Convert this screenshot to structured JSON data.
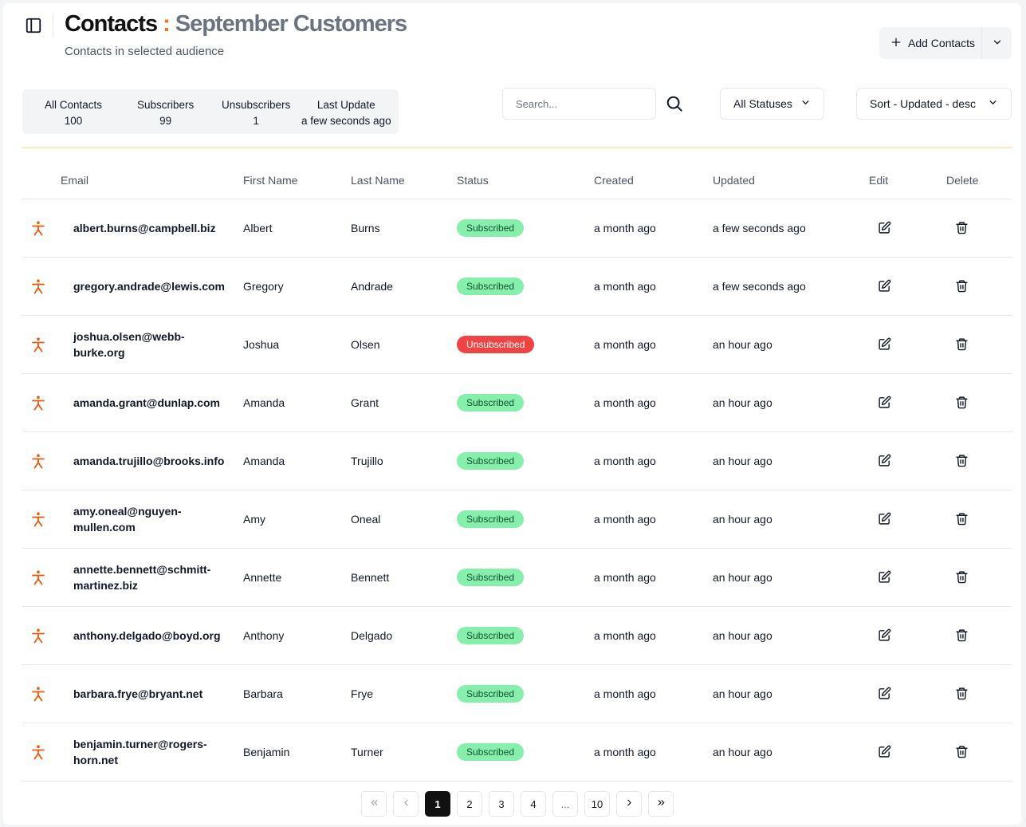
{
  "header": {
    "title_main": "Contacts",
    "title_separator": ":",
    "title_audience": "September Customers",
    "subtitle": "Contacts in selected audience",
    "add_button": "Add Contacts"
  },
  "stats": {
    "all": {
      "label": "All Contacts",
      "value": "100"
    },
    "subscribers": {
      "label": "Subscribers",
      "value": "99"
    },
    "unsubscribers": {
      "label": "Unsubscribers",
      "value": "1"
    },
    "last_update": {
      "label": "Last Update",
      "value": "a few seconds ago"
    }
  },
  "search": {
    "placeholder": "Search..."
  },
  "filters": {
    "status": "All Statuses",
    "sort": "Sort - Updated - desc"
  },
  "table": {
    "headers": {
      "email": "Email",
      "first": "First Name",
      "last": "Last Name",
      "status": "Status",
      "created": "Created",
      "updated": "Updated",
      "edit": "Edit",
      "delete": "Delete"
    },
    "rows": [
      {
        "email": "albert.burns@campbell.biz",
        "first": "Albert",
        "last": "Burns",
        "status": "Subscribed",
        "created": "a month ago",
        "updated": "a few seconds ago"
      },
      {
        "email": "gregory.andrade@lewis.com",
        "first": "Gregory",
        "last": "Andrade",
        "status": "Subscribed",
        "created": "a month ago",
        "updated": "a few seconds ago"
      },
      {
        "email": "joshua.olsen@webb-burke.org",
        "first": "Joshua",
        "last": "Olsen",
        "status": "Unsubscribed",
        "created": "a month ago",
        "updated": "an hour ago"
      },
      {
        "email": "amanda.grant@dunlap.com",
        "first": "Amanda",
        "last": "Grant",
        "status": "Subscribed",
        "created": "a month ago",
        "updated": "an hour ago"
      },
      {
        "email": "amanda.trujillo@brooks.info",
        "first": "Amanda",
        "last": "Trujillo",
        "status": "Subscribed",
        "created": "a month ago",
        "updated": "an hour ago"
      },
      {
        "email": "amy.oneal@nguyen-mullen.com",
        "first": "Amy",
        "last": "Oneal",
        "status": "Subscribed",
        "created": "a month ago",
        "updated": "an hour ago"
      },
      {
        "email": "annette.bennett@schmitt-martinez.biz",
        "first": "Annette",
        "last": "Bennett",
        "status": "Subscribed",
        "created": "a month ago",
        "updated": "an hour ago"
      },
      {
        "email": "anthony.delgado@boyd.org",
        "first": "Anthony",
        "last": "Delgado",
        "status": "Subscribed",
        "created": "a month ago",
        "updated": "an hour ago"
      },
      {
        "email": "barbara.frye@bryant.net",
        "first": "Barbara",
        "last": "Frye",
        "status": "Subscribed",
        "created": "a month ago",
        "updated": "an hour ago"
      },
      {
        "email": "benjamin.turner@rogers-horn.net",
        "first": "Benjamin",
        "last": "Turner",
        "status": "Subscribed",
        "created": "a month ago",
        "updated": "an hour ago"
      }
    ]
  },
  "pagination": {
    "pages": [
      "1",
      "2",
      "3",
      "4"
    ],
    "ellipsis": "...",
    "last": "10",
    "current": "1"
  },
  "colors": {
    "accent": "#f97316",
    "subscribed_bg": "#86efac",
    "unsubscribed_bg": "#ef4444"
  },
  "icons": {
    "sidebar": "sidebar-toggle-icon",
    "plus": "plus-icon",
    "chevron": "chevron-down-icon",
    "search": "search-icon",
    "person": "person-icon",
    "edit": "edit-icon",
    "delete": "trash-icon"
  }
}
